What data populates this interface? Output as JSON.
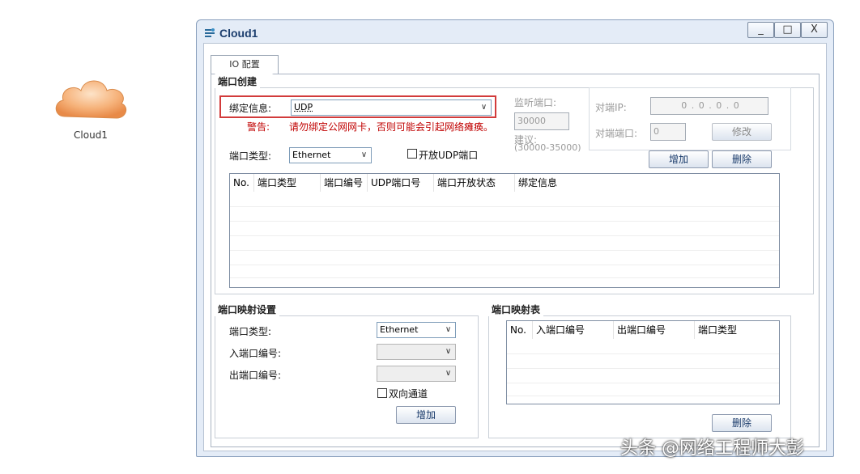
{
  "desktop": {
    "device_label": "Cloud1"
  },
  "window": {
    "title": "Cloud1",
    "controls": {
      "minimize": "_",
      "maximize": "□",
      "close": "X"
    },
    "tab_label": "IO 配置"
  },
  "port_create": {
    "group_title": "端口创建",
    "bind_label": "绑定信息:",
    "bind_value": "UDP",
    "warning_label": "警告:",
    "warning_text": "请勿绑定公网网卡，否则可能会引起网络瘫痪。",
    "port_type_label": "端口类型:",
    "port_type_value": "Ethernet",
    "open_udp_label": "开放UDP端口",
    "listen_port_label": "监听端口:",
    "listen_port_value": "30000",
    "suggest_label": "建议:",
    "suggest_range": "(30000-35000)",
    "peer_ip_label": "对端IP:",
    "peer_ip_value": "0 . 0 . 0 . 0",
    "peer_port_label": "对端端口:",
    "peer_port_value": "0",
    "modify_button": "修改",
    "add_button": "增加",
    "delete_button": "删除",
    "table_headers": [
      "No.",
      "端口类型",
      "端口编号",
      "UDP端口号",
      "端口开放状态",
      "绑定信息"
    ]
  },
  "port_mapping_settings": {
    "group_title": "端口映射设置",
    "port_type_label": "端口类型:",
    "port_type_value": "Ethernet",
    "in_port_label": "入端口编号:",
    "out_port_label": "出端口编号:",
    "bidirectional_label": "双向通道",
    "add_button": "增加"
  },
  "port_mapping_table": {
    "group_title": "端口映射表",
    "table_headers": [
      "No.",
      "入端口编号",
      "出端口编号",
      "端口类型"
    ],
    "delete_button": "删除"
  },
  "watermark": "头条 @网络工程师大彭",
  "colors": {
    "highlight": "#d23b3b",
    "warning": "#c00000",
    "window_bg": "#e4ecf7"
  }
}
